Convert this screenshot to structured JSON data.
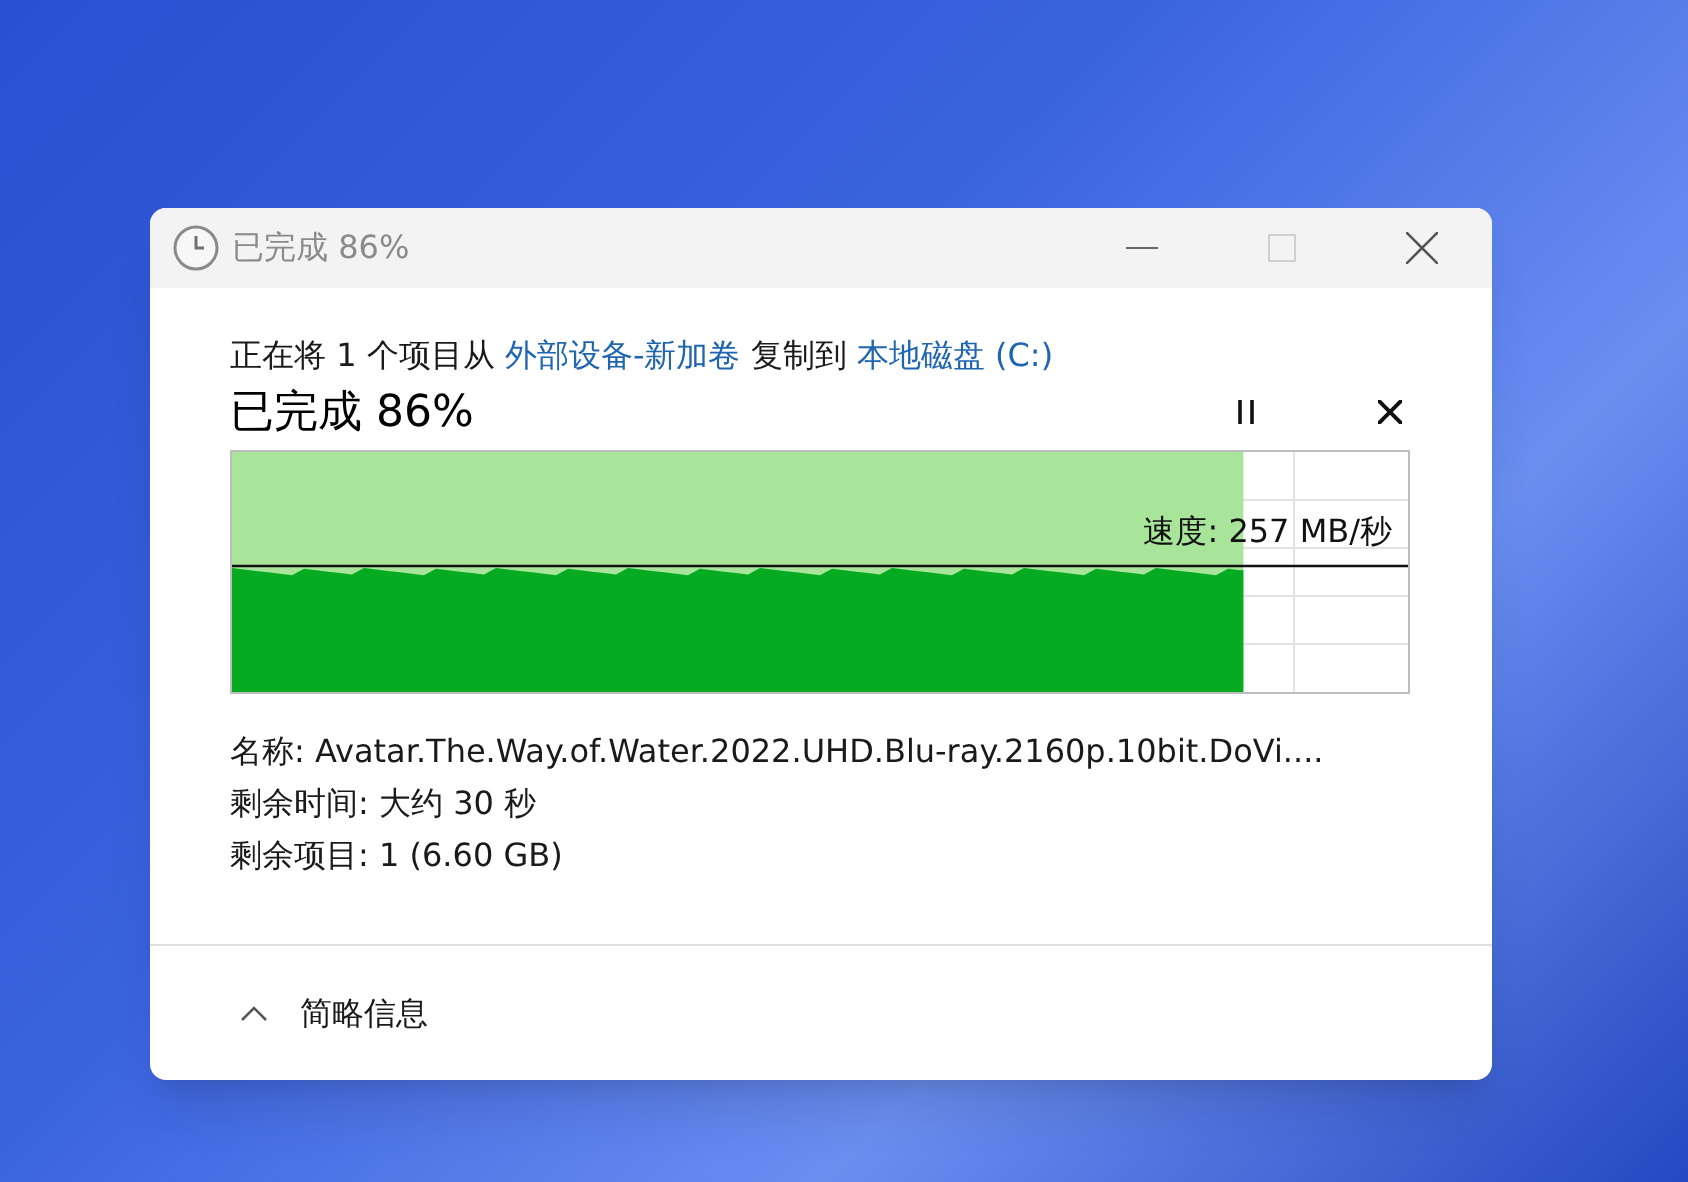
{
  "window": {
    "title": "已完成 86%"
  },
  "copy": {
    "prefix": "正在将 1 个项目从",
    "source": "外部设备-新加卷",
    "middle": "复制到",
    "destination": "本地磁盘 (C:)"
  },
  "progress": {
    "heading": "已完成 86%",
    "level": 0.86,
    "speed": "速度: 257 MB/秒"
  },
  "details": [
    {
      "label": "名称:",
      "value": "Avatar.The.Way.of.Water.2022.UHD.Blu-ray.2160p.10bit.DoVi...."
    },
    {
      "label": "剩余时间:",
      "value": "大约 30 秒"
    },
    {
      "label": "剩余项目:",
      "value": "1 (6.60 GB)"
    }
  ],
  "more_details": {
    "label": "简略信息",
    "expanded": true
  }
}
